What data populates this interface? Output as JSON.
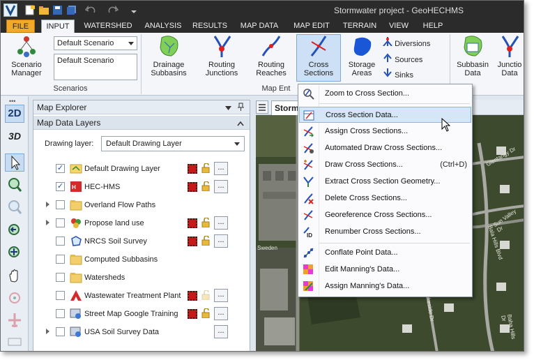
{
  "window": {
    "title": "Stormwater project - GeoHECHMS"
  },
  "ribbon_tabs": [
    "FILE",
    "INPUT",
    "WATERSHED",
    "ANALYSIS",
    "RESULTS",
    "MAP DATA",
    "MAP EDIT",
    "TERRAIN",
    "VIEW",
    "HELP"
  ],
  "active_tab": "INPUT",
  "scenarios": {
    "manager_label_1": "Scenario",
    "manager_label_2": "Manager",
    "combo_value": "Default Scenario",
    "list_value": "Default Scenario",
    "group_label": "Scenarios"
  },
  "map_entities": {
    "group_label": "Map Ent",
    "buttons": [
      {
        "line1": "Drainage",
        "line2": "Subbasins"
      },
      {
        "line1": "Routing",
        "line2": "Junctions"
      },
      {
        "line1": "Routing",
        "line2": "Reaches"
      },
      {
        "line1": "Cross",
        "line2": "Sections"
      },
      {
        "line1": "Storage",
        "line2": "Areas"
      }
    ],
    "small_buttons": [
      "Diversions",
      "Sources",
      "Sinks"
    ],
    "right_buttons": [
      {
        "line1": "Subbasin",
        "line2": "Data"
      },
      {
        "line1": "Junctio",
        "line2": "Data"
      }
    ]
  },
  "map_explorer": {
    "title": "Map Explorer",
    "pin": "−1",
    "layers_header": "Map Data Layers",
    "drawing_layer_label": "Drawing layer:",
    "drawing_layer_value": "Default Drawing Layer",
    "layers": [
      {
        "name": "Default Drawing Layer",
        "checked": true
      },
      {
        "name": "HEC-HMS",
        "checked": true
      },
      {
        "name": "Overland Flow Paths",
        "checked": false
      },
      {
        "name": "Propose land use",
        "checked": false
      },
      {
        "name": "NRCS Soil Survey",
        "checked": false
      },
      {
        "name": "Computed Subbasins",
        "checked": false
      },
      {
        "name": "Watersheds",
        "checked": false
      },
      {
        "name": "Wastewater Treatment Plant",
        "checked": false
      },
      {
        "name": "Street Map Google Training",
        "checked": false
      },
      {
        "name": "USA Soil Survey Data",
        "checked": false
      }
    ],
    "dots_label": "..."
  },
  "map_view": {
    "tab_label": "Storm",
    "street_labels": [
      "Glentangy Dr",
      "Sun Valley Dr",
      "Bala Hills Blvd",
      "Lakeside Dr",
      "Baha Hills Dr",
      "Sweden"
    ]
  },
  "cross_section_menu": {
    "items": [
      {
        "label": "Zoom to Cross Section...",
        "shortcut": "",
        "icon": "zoom-cross-section-icon"
      },
      {
        "label": "Cross Section Data...",
        "shortcut": "",
        "icon": "cross-section-data-icon"
      },
      {
        "label": "Assign Cross Sections...",
        "shortcut": "",
        "icon": "assign-cross-sections-icon"
      },
      {
        "label": "Automated Draw Cross Sections...",
        "shortcut": "",
        "icon": "automated-draw-icon"
      },
      {
        "label": "Draw Cross Sections...",
        "shortcut": "(Ctrl+D)",
        "icon": "draw-cross-sections-icon"
      },
      {
        "label": "Extract Cross Section Geometry...",
        "shortcut": "",
        "icon": "extract-geometry-icon"
      },
      {
        "label": "Delete Cross Sections...",
        "shortcut": "",
        "icon": "delete-cross-sections-icon"
      },
      {
        "label": "Georeference Cross Sections...",
        "shortcut": "",
        "icon": "georeference-icon"
      },
      {
        "label": "Renumber Cross Sections...",
        "shortcut": "",
        "icon": "renumber-icon"
      },
      {
        "label": "Conflate Point Data...",
        "shortcut": "",
        "icon": "conflate-icon"
      },
      {
        "label": "Edit Manning's Data...",
        "shortcut": "",
        "icon": "edit-manning-icon"
      },
      {
        "label": "Assign Manning's Data...",
        "shortcut": "",
        "icon": "assign-manning-icon"
      }
    ],
    "highlighted_index": 1
  },
  "view_buttons": [
    "2D",
    "3D"
  ],
  "colors": {
    "titlebar": "#2b2b2b",
    "file_tab": "#f2a92a",
    "highlight": "#d5e6f7",
    "layer_symbol": "#c81818"
  }
}
